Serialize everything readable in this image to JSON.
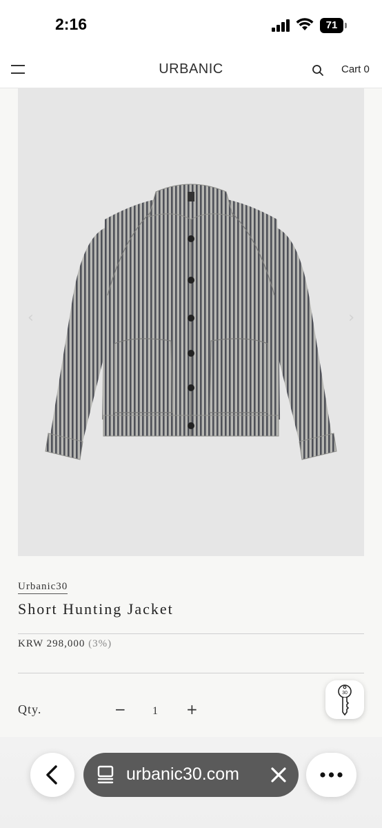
{
  "status_bar": {
    "time": "2:16",
    "battery": "71",
    "icons": [
      "signal-icon",
      "wifi-icon",
      "battery-icon"
    ]
  },
  "header": {
    "logo": "URBANIC",
    "cart_label": "Cart 0",
    "icons": [
      "menu-icon",
      "search-icon"
    ]
  },
  "product": {
    "brand": "Urbanic30",
    "title": "Short Hunting Jacket",
    "price": "KRW 298,000",
    "discount": "(3%)",
    "qty_label": "Qty.",
    "qty_value": "1",
    "qty_minus": "−",
    "qty_plus": "+",
    "image_subject": "striped-jacket-photo"
  },
  "browser": {
    "url": "urbanic30.com",
    "icons": [
      "back-chevron-icon",
      "tabs-icon",
      "close-icon",
      "more-icon"
    ]
  },
  "colors": {
    "page_background": "#f7f7f5",
    "image_background": "#e6e6e6",
    "url_pill": "#5a5a5a"
  }
}
